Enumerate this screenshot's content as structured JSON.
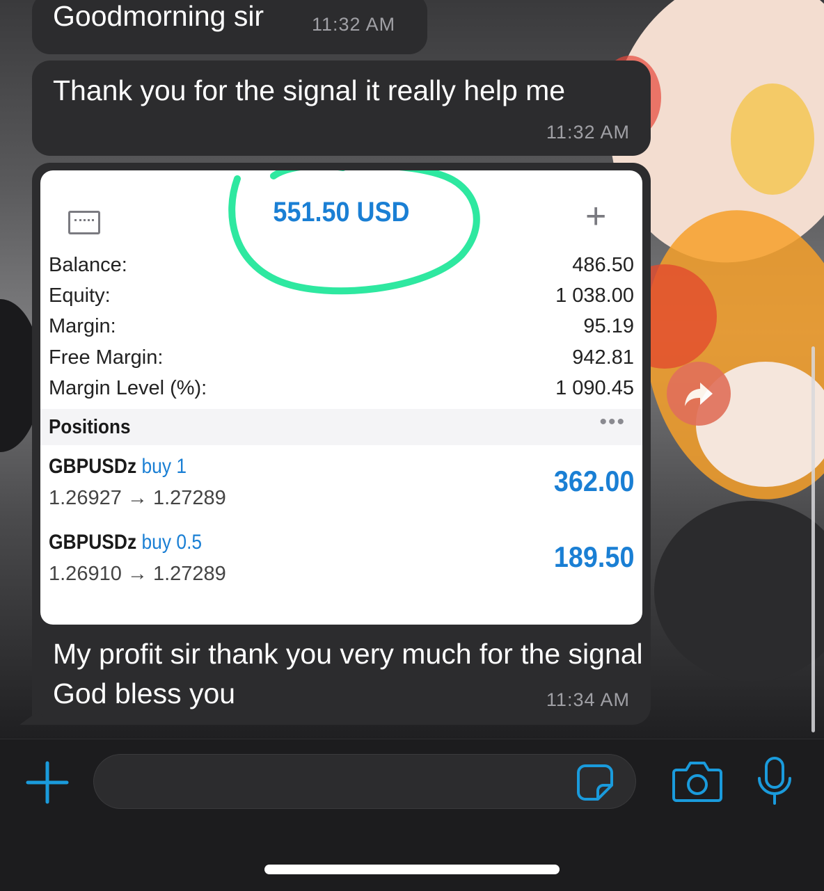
{
  "messages": [
    {
      "text": "Goodmorning sir",
      "time": "11:32 AM"
    },
    {
      "text": "Thank you for the signal it really help me",
      "time": "11:32 AM"
    },
    {
      "text": "My profit sir thank you very much for the signal God bless you",
      "time": "11:34 AM"
    }
  ],
  "screenshot": {
    "total": "551.50 USD",
    "plus": "+",
    "account": [
      {
        "label": "Balance:",
        "value": "486.50"
      },
      {
        "label": "Equity:",
        "value": "1 038.00"
      },
      {
        "label": "Margin:",
        "value": "95.19"
      },
      {
        "label": "Free Margin:",
        "value": "942.81"
      },
      {
        "label": "Margin Level (%):",
        "value": "1 090.45"
      }
    ],
    "positions_label": "Positions",
    "more": "•••",
    "positions": [
      {
        "symbol": "GBPUSDz",
        "side": "buy 1",
        "prices": "1.26927 → 1.27289",
        "profit": "362.00"
      },
      {
        "symbol": "GBPUSDz",
        "side": "buy 0.5",
        "prices": "1.26910 → 1.27289",
        "profit": "189.50"
      }
    ]
  },
  "composer": {
    "placeholder": ""
  },
  "icons": [
    "wallet-icon",
    "forward-icon",
    "plus-icon",
    "sticker-icon",
    "camera-icon",
    "microphone-icon"
  ],
  "colors": {
    "accent": "#1a9bdc",
    "bubble": "#2c2c2e",
    "mt_blue": "#1a7fd4",
    "highlight": "#2ee8a0"
  }
}
